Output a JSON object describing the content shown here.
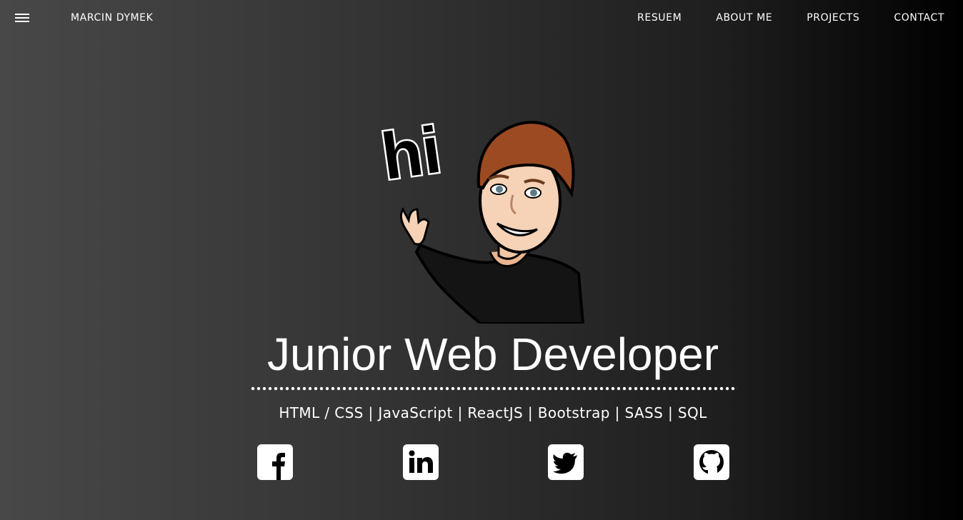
{
  "header": {
    "brand": "MARCIN DYMEK",
    "menu_icon": "hamburger-menu-icon",
    "nav": [
      {
        "label": "RESUEM"
      },
      {
        "label": "ABOUT ME"
      },
      {
        "label": "PROJECTS"
      },
      {
        "label": "CONTACT"
      }
    ]
  },
  "hero": {
    "avatar_text": "hi",
    "title": "Junior Web Developer",
    "skills": "HTML / CSS | JavaScript | ReactJS | Bootstrap | SASS | SQL"
  },
  "social": [
    {
      "icon": "facebook-icon"
    },
    {
      "icon": "linkedin-icon"
    },
    {
      "icon": "twitter-icon"
    },
    {
      "icon": "github-icon"
    }
  ],
  "colors": {
    "text": "#ffffff",
    "background_left": "#484848",
    "background_right": "#000000",
    "skin": "#f6d2b6",
    "hair": "#9c4a22"
  }
}
